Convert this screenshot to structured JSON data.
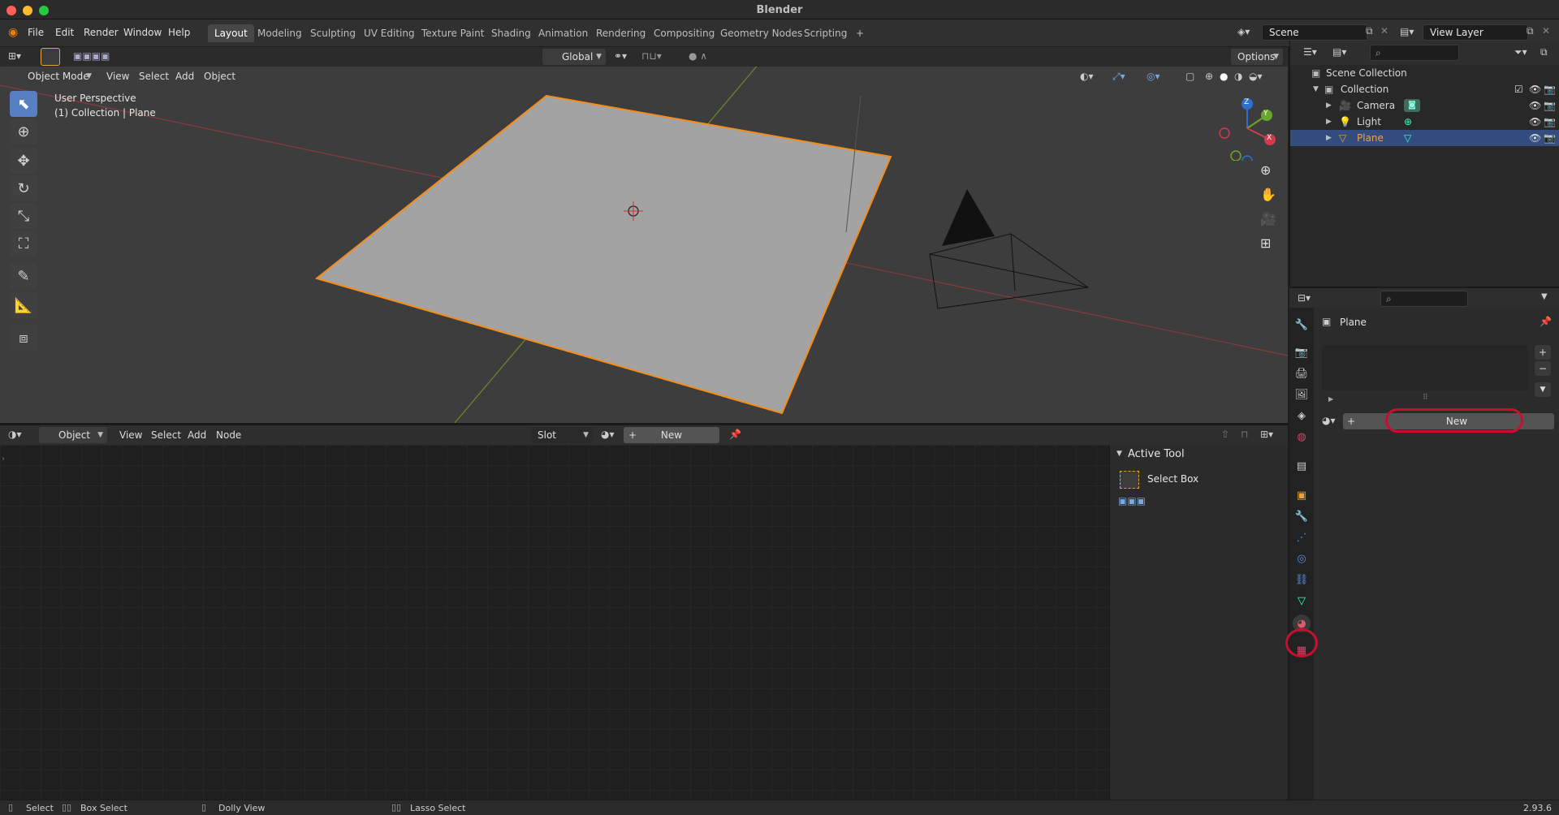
{
  "window": {
    "title": "Blender"
  },
  "menu": {
    "items": [
      "File",
      "Edit",
      "Render",
      "Window",
      "Help"
    ]
  },
  "workspaces": {
    "tabs": [
      "Layout",
      "Modeling",
      "Sculpting",
      "UV Editing",
      "Texture Paint",
      "Shading",
      "Animation",
      "Rendering",
      "Compositing",
      "Geometry Nodes",
      "Scripting"
    ],
    "active": "Layout",
    "add": "+"
  },
  "scene": {
    "name": "Scene"
  },
  "view_layer": {
    "name": "View Layer"
  },
  "viewport": {
    "mode": "Object Mode",
    "menus": [
      "View",
      "Select",
      "Add",
      "Object"
    ],
    "orientation": "Global",
    "options_label": "Options",
    "overlay_line1": "User Perspective",
    "overlay_line2": "(1) Collection | Plane",
    "gizmo": {
      "x": "X",
      "y": "Y",
      "z": "Z"
    }
  },
  "node_editor": {
    "type": "Object",
    "menus": [
      "View",
      "Select",
      "Add",
      "Node"
    ],
    "slot": "Slot",
    "new_label": "New",
    "sidebar": {
      "panel_title": "Active Tool",
      "tool_name": "Select Box"
    }
  },
  "outliner": {
    "rows": [
      {
        "label": "Scene Collection"
      },
      {
        "label": "Collection"
      },
      {
        "label": "Camera"
      },
      {
        "label": "Light"
      },
      {
        "label": "Plane"
      }
    ]
  },
  "properties": {
    "object_name": "Plane",
    "new_label": "New"
  },
  "statusbar": {
    "items": [
      "Select",
      "Box Select",
      "Dolly View",
      "Lasso Select"
    ],
    "version": "2.93.6"
  },
  "colors": {
    "accent_blue": "#5680c2",
    "selection_orange": "#f0a13d",
    "highlight_red": "#c8102e"
  }
}
